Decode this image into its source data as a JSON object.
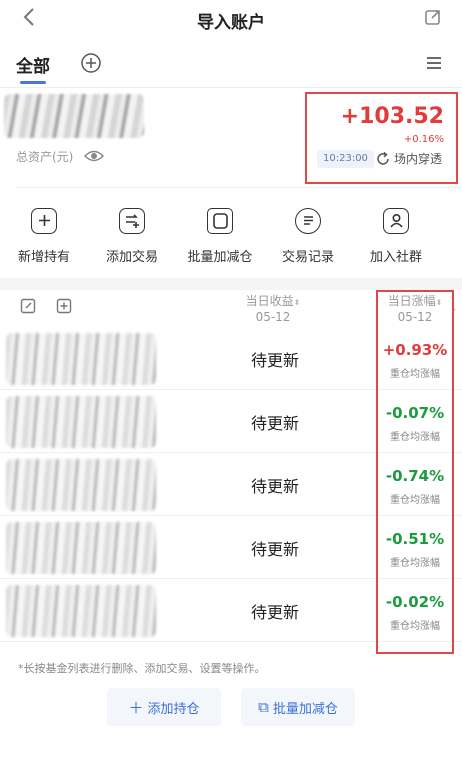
{
  "header": {
    "title": "导入账户",
    "back_icon": "chevron-left-icon",
    "share_icon": "share-icon"
  },
  "tabs": {
    "active": "全部",
    "add_icon": "plus-circle-icon",
    "menu_icon": "menu-icon"
  },
  "summary": {
    "total_label": "总资产(元)",
    "daily_pnl": "+103.52",
    "daily_pnl_pct": "+0.16%",
    "time": "10:23:00",
    "penetrate_label": "场内穿透",
    "accent_red": "#e03c3c"
  },
  "actions": [
    {
      "label": "新增持有",
      "icon": "plus-box-icon"
    },
    {
      "label": "添加交易",
      "icon": "trade-add-icon"
    },
    {
      "label": "批量加减仓",
      "icon": "batch-copy-icon"
    },
    {
      "label": "交易记录",
      "icon": "record-icon"
    },
    {
      "label": "加入社群",
      "icon": "group-icon"
    }
  ],
  "list": {
    "col_income": "当日收益",
    "col_change": "当日涨幅",
    "date": "05-12",
    "rows": [
      {
        "status": "待更新",
        "change": "+0.93%",
        "sub": "重仓均涨幅",
        "color": "#e03c3c"
      },
      {
        "status": "待更新",
        "change": "-0.07%",
        "sub": "重仓均涨幅",
        "color": "#1a9c3e"
      },
      {
        "status": "待更新",
        "change": "-0.74%",
        "sub": "重仓均涨幅",
        "color": "#1a9c3e"
      },
      {
        "status": "待更新",
        "change": "-0.51%",
        "sub": "重仓均涨幅",
        "color": "#1a9c3e"
      },
      {
        "status": "待更新",
        "change": "-0.02%",
        "sub": "重仓均涨幅",
        "color": "#1a9c3e"
      }
    ]
  },
  "footer": {
    "hint": "*长按基金列表进行删除、添加交易、设置等操作。",
    "add_btn": "添加持仓",
    "batch_btn": "批量加减仓"
  }
}
